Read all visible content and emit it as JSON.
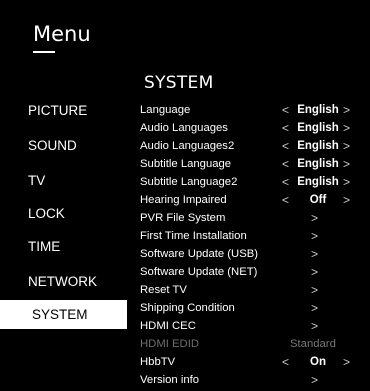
{
  "header": {
    "title": "Menu"
  },
  "section_title": "SYSTEM",
  "sidebar": {
    "items": [
      {
        "label": "PICTURE",
        "selected": false
      },
      {
        "label": "SOUND",
        "selected": false
      },
      {
        "label": "TV",
        "selected": false
      },
      {
        "label": "LOCK",
        "selected": false
      },
      {
        "label": "TIME",
        "selected": false
      },
      {
        "label": "NETWORK",
        "selected": false
      },
      {
        "label": "SYSTEM",
        "selected": true
      }
    ]
  },
  "settings": [
    {
      "label": "Language",
      "value": "English",
      "type": "select"
    },
    {
      "label": "Audio Languages",
      "value": "English",
      "type": "select"
    },
    {
      "label": "Audio Languages2",
      "value": "English",
      "type": "select"
    },
    {
      "label": "Subtitle Language",
      "value": "English",
      "type": "select"
    },
    {
      "label": "Subtitle Language2",
      "value": "English",
      "type": "select"
    },
    {
      "label": "Hearing Impaired",
      "value": "Off",
      "type": "select"
    },
    {
      "label": "PVR File System",
      "type": "submenu"
    },
    {
      "label": "First Time Installation",
      "type": "submenu"
    },
    {
      "label": "Software Update (USB)",
      "type": "submenu"
    },
    {
      "label": "Software Update (NET)",
      "type": "submenu"
    },
    {
      "label": "Reset TV",
      "type": "submenu"
    },
    {
      "label": "Shipping Condition",
      "type": "submenu"
    },
    {
      "label": "HDMI CEC",
      "type": "submenu"
    },
    {
      "label": "HDMI EDID",
      "value": "Standard",
      "type": "disabled"
    },
    {
      "label": "HbbTV",
      "value": "On",
      "type": "select"
    },
    {
      "label": "Version info",
      "type": "submenu"
    }
  ],
  "glyphs": {
    "left": "<",
    "right": ">"
  },
  "colors": {
    "background": "#000000",
    "text": "#ffffff",
    "selected_bg": "#ffffff",
    "disabled": "#6e6e6e"
  }
}
